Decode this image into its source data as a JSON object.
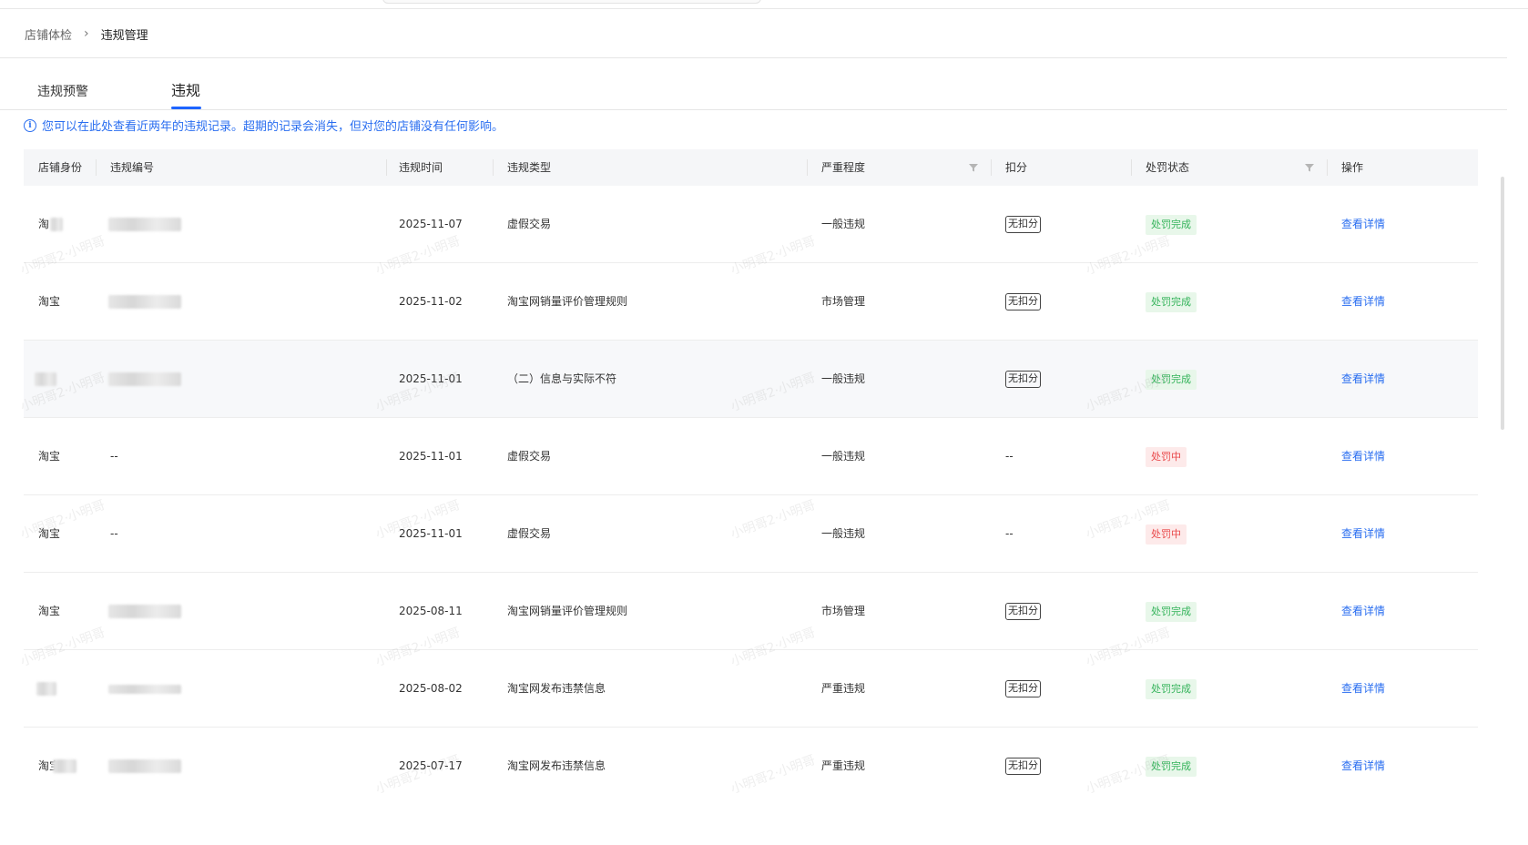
{
  "breadcrumb": {
    "root": "店铺体检",
    "separator": "›",
    "current": "违规管理"
  },
  "tabs": [
    {
      "label": "违规预警",
      "active": false
    },
    {
      "label": "违规",
      "active": true
    }
  ],
  "notice": {
    "icon": "info-icon",
    "text": "您可以在此处查看近两年的违规记录。超期的记录会消失，但对您的店铺没有任何影响。"
  },
  "table": {
    "headers": {
      "shop": "店铺身份",
      "code": "违规编号",
      "time": "违规时间",
      "type": "违规类型",
      "severity": "严重程度",
      "score": "扣分",
      "status": "处罚状态",
      "action": "操作"
    },
    "rows": [
      {
        "shop": "淘",
        "code": "",
        "time": "2025-11-07",
        "type": "虚假交易",
        "severity": "一般违规",
        "score": "无扣分",
        "status": "处罚完成",
        "action": "查看详情"
      },
      {
        "shop": "淘宝",
        "code": "",
        "time": "2025-11-02",
        "type": "淘宝网销量评价管理规则",
        "severity": "市场管理",
        "score": "无扣分",
        "status": "处罚完成",
        "action": "查看详情"
      },
      {
        "shop": "",
        "code": "",
        "time": "2025-11-01",
        "type": "（二）信息与实际不符",
        "severity": "一般违规",
        "score": "无扣分",
        "status": "处罚完成",
        "action": "查看详情"
      },
      {
        "shop": "淘宝",
        "code": "--",
        "time": "2025-11-01",
        "type": "虚假交易",
        "severity": "一般违规",
        "score": "--",
        "status": "处罚中",
        "action": "查看详情"
      },
      {
        "shop": "淘宝",
        "code": "--",
        "time": "2025-11-01",
        "type": "虚假交易",
        "severity": "一般违规",
        "score": "--",
        "status": "处罚中",
        "action": "查看详情"
      },
      {
        "shop": "淘宝",
        "code": "",
        "time": "2025-08-11",
        "type": "淘宝网销量评价管理规则",
        "severity": "市场管理",
        "score": "无扣分",
        "status": "处罚完成",
        "action": "查看详情"
      },
      {
        "shop": "",
        "code": "",
        "time": "2025-08-02",
        "type": "淘宝网发布违禁信息",
        "severity": "严重违规",
        "score": "无扣分",
        "status": "处罚完成",
        "action": "查看详情"
      },
      {
        "shop": "淘宝",
        "code": "",
        "time": "2025-07-17",
        "type": "淘宝网发布违禁信息",
        "severity": "严重违规",
        "score": "无扣分",
        "status": "处罚完成",
        "action": "查看详情"
      }
    ]
  },
  "watermark": "小明哥2·小明哥",
  "colors": {
    "accent": "#1e64ff",
    "link": "#2a6ef0",
    "done_bg": "#e8f7ea",
    "done_fg": "#34b35a",
    "pending_bg": "#fdeaea",
    "pending_fg": "#e9484a"
  }
}
